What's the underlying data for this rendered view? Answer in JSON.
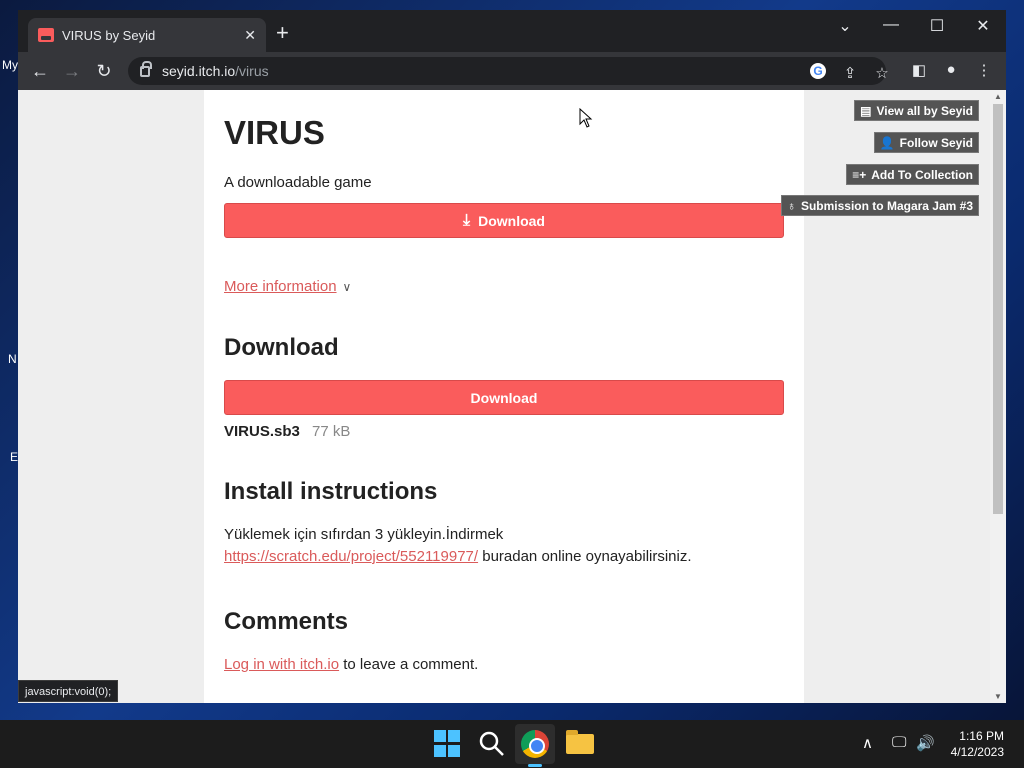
{
  "desktop": {
    "labels": [
      "My",
      "N",
      "E"
    ]
  },
  "browser": {
    "tab_title": "VIRUS by Seyid",
    "tab_close": "✕",
    "new_tab": "+",
    "controls": {
      "menu": "⌄",
      "minimize": "—",
      "maximize": "☐",
      "close": "✕"
    },
    "url_host": "seyid.itch.io",
    "url_path": "/virus"
  },
  "page": {
    "title": "VIRUS",
    "tagline": "A downloadable game",
    "top_download_label": "Download",
    "more_info": "More information",
    "download_heading": "Download",
    "download_label": "Download",
    "file_name": "VIRUS.sb3",
    "file_size": "77 kB",
    "install_heading": "Install instructions",
    "install_line1": "Yüklemek için sıfırdan 3 yükleyin.İndirmek",
    "install_link": "https://scratch.edu/project/552119977/",
    "install_line2": " buradan   online oynayabilirsiniz.",
    "comments_heading": "Comments",
    "login_link": "Log in with itch.io",
    "login_suffix": " to leave a comment."
  },
  "sidebar": {
    "view_all": "View all by Seyid",
    "follow": "Follow Seyid",
    "add_collection": "Add To Collection",
    "submission": "Submission to Magara Jam #3"
  },
  "status_bar": "javascript:void(0);",
  "taskbar": {
    "time": "1:16 PM",
    "date": "4/12/2023"
  }
}
